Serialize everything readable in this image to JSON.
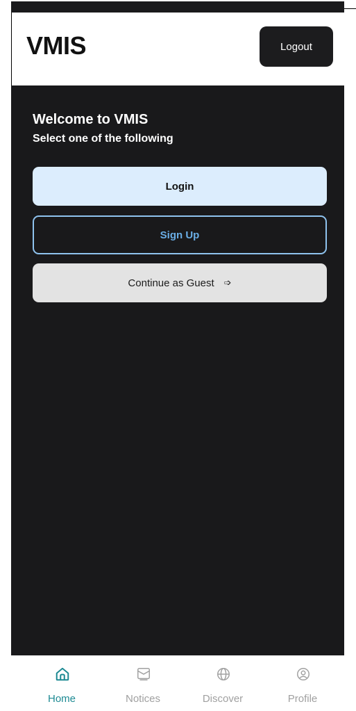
{
  "app": {
    "title": "VMIS",
    "logout_label": "Logout"
  },
  "welcome": {
    "title": "Welcome to VMIS",
    "subtitle": "Select one of the following"
  },
  "actions": {
    "login_label": "Login",
    "signup_label": "Sign Up",
    "guest_label": "Continue as Guest",
    "guest_icon": "arrow-right-icon"
  },
  "nav": {
    "items": [
      {
        "label": "Home",
        "icon": "home-icon",
        "active": true
      },
      {
        "label": "Notices",
        "icon": "mail-icon",
        "active": false
      },
      {
        "label": "Discover",
        "icon": "globe-icon",
        "active": false
      },
      {
        "label": "Profile",
        "icon": "profile-icon",
        "active": false
      }
    ]
  },
  "colors": {
    "active": "#1d8a93",
    "inactive": "#a0a0a0",
    "background": "#19191b",
    "login_bg": "#dcedfd",
    "signup_border": "#8fc3ef",
    "guest_bg": "#e3e3e3"
  }
}
